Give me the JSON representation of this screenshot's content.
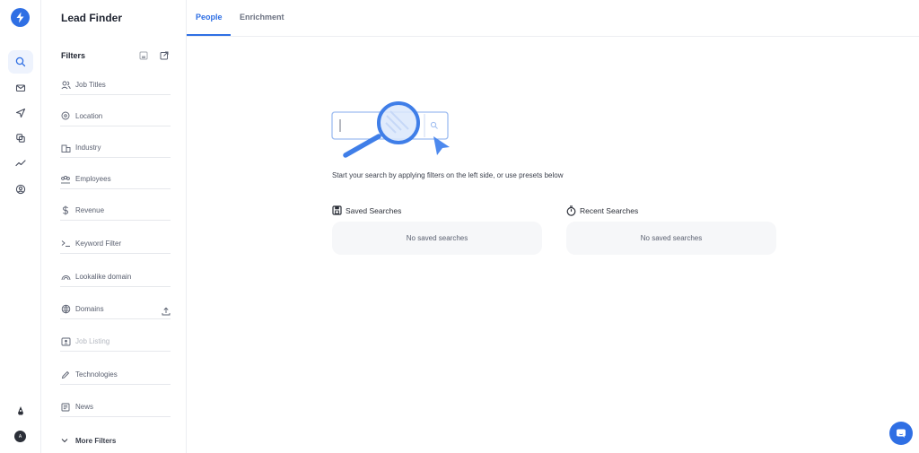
{
  "app": {
    "title": "Lead Finder",
    "accent": "#2f6fe4"
  },
  "rail": {
    "items": [
      {
        "icon": "search-icon"
      },
      {
        "icon": "mail-icon"
      },
      {
        "icon": "send-icon"
      },
      {
        "icon": "copy-icon"
      },
      {
        "icon": "trend-icon"
      },
      {
        "icon": "user-circle-icon"
      }
    ],
    "avatar_initial": "A"
  },
  "tabs": [
    {
      "label": "People",
      "active": true
    },
    {
      "label": "Enrichment",
      "active": false
    }
  ],
  "filters": {
    "heading": "Filters",
    "items": [
      {
        "label": "Job Titles",
        "icon": "people-icon"
      },
      {
        "label": "Location",
        "icon": "location-pin-icon"
      },
      {
        "label": "Industry",
        "icon": "building-icon"
      },
      {
        "label": "Employees",
        "icon": "group-icon"
      },
      {
        "label": "Revenue",
        "icon": "dollar-icon"
      },
      {
        "label": "Keyword Filter",
        "icon": "terminal-icon"
      },
      {
        "label": "Lookalike domain",
        "icon": "rainbow-icon"
      },
      {
        "label": "Domains",
        "icon": "globe-icon"
      },
      {
        "label": "Job Listing",
        "icon": "id-card-icon",
        "disabled": true
      },
      {
        "label": "Technologies",
        "icon": "pen-icon"
      },
      {
        "label": "News",
        "icon": "newspaper-icon"
      }
    ],
    "more_label": "More Filters"
  },
  "main": {
    "hint": "Start your search by applying filters on the left side, or use presets below",
    "saved": {
      "title": "Saved Searches",
      "empty": "No saved searches"
    },
    "recent": {
      "title": "Recent Searches",
      "empty": "No saved searches"
    }
  }
}
